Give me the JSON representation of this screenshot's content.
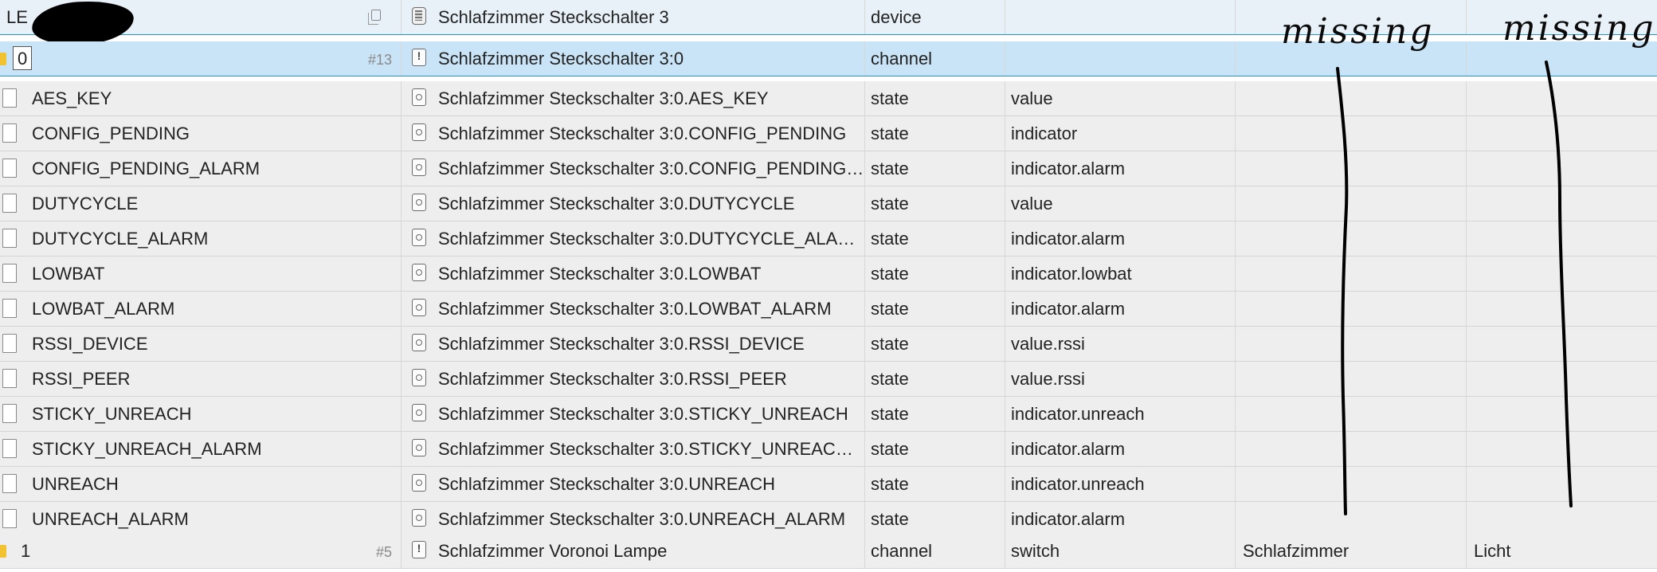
{
  "device": {
    "id_partial": "LE",
    "name": "Schlafzimmer Steckschalter 3",
    "type": "device"
  },
  "selected_channel": {
    "id": "0",
    "count": "#13",
    "name": "Schlafzimmer Steckschalter 3:0",
    "type": "channel"
  },
  "states": [
    {
      "id": "AES_KEY",
      "name": "Schlafzimmer Steckschalter 3:0.AES_KEY",
      "type": "state",
      "role": "value"
    },
    {
      "id": "CONFIG_PENDING",
      "name": "Schlafzimmer Steckschalter 3:0.CONFIG_PENDING",
      "type": "state",
      "role": "indicator"
    },
    {
      "id": "CONFIG_PENDING_ALARM",
      "name": "Schlafzimmer Steckschalter 3:0.CONFIG_PENDING_...",
      "type": "state",
      "role": "indicator.alarm"
    },
    {
      "id": "DUTYCYCLE",
      "name": "Schlafzimmer Steckschalter 3:0.DUTYCYCLE",
      "type": "state",
      "role": "value"
    },
    {
      "id": "DUTYCYCLE_ALARM",
      "name": "Schlafzimmer Steckschalter 3:0.DUTYCYCLE_ALARM",
      "type": "state",
      "role": "indicator.alarm"
    },
    {
      "id": "LOWBAT",
      "name": "Schlafzimmer Steckschalter 3:0.LOWBAT",
      "type": "state",
      "role": "indicator.lowbat"
    },
    {
      "id": "LOWBAT_ALARM",
      "name": "Schlafzimmer Steckschalter 3:0.LOWBAT_ALARM",
      "type": "state",
      "role": "indicator.alarm"
    },
    {
      "id": "RSSI_DEVICE",
      "name": "Schlafzimmer Steckschalter 3:0.RSSI_DEVICE",
      "type": "state",
      "role": "value.rssi"
    },
    {
      "id": "RSSI_PEER",
      "name": "Schlafzimmer Steckschalter 3:0.RSSI_PEER",
      "type": "state",
      "role": "value.rssi"
    },
    {
      "id": "STICKY_UNREACH",
      "name": "Schlafzimmer Steckschalter 3:0.STICKY_UNREACH",
      "type": "state",
      "role": "indicator.unreach"
    },
    {
      "id": "STICKY_UNREACH_ALARM",
      "name": "Schlafzimmer Steckschalter 3:0.STICKY_UNREACH_...",
      "type": "state",
      "role": "indicator.alarm"
    },
    {
      "id": "UNREACH",
      "name": "Schlafzimmer Steckschalter 3:0.UNREACH",
      "type": "state",
      "role": "indicator.unreach"
    },
    {
      "id": "UNREACH_ALARM",
      "name": "Schlafzimmer Steckschalter 3:0.UNREACH_ALARM",
      "type": "state",
      "role": "indicator.alarm"
    }
  ],
  "next_channel": {
    "id": "1",
    "count": "#5",
    "name": "Schlafzimmer Voronoi Lampe",
    "type": "channel",
    "role": "switch",
    "room": "Schlafzimmer",
    "function": "Licht"
  },
  "annotations": {
    "room_note": "missing",
    "function_note": "missing"
  },
  "colors": {
    "selection": "#c9e4f6",
    "accent_border": "#2d8fc7",
    "folder": "#f2c230"
  }
}
